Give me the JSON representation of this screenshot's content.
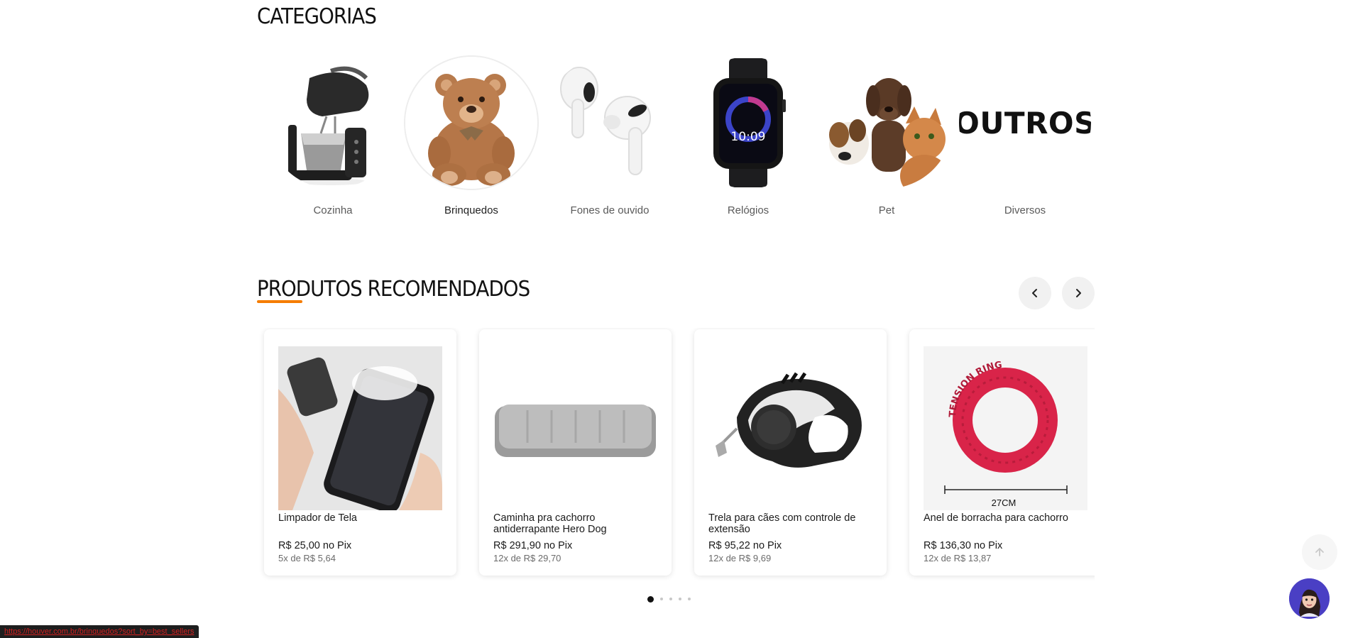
{
  "categories": {
    "title": "CATEGORIAS",
    "items": [
      {
        "label": "Cozinha",
        "icon": "stand-mixer-image"
      },
      {
        "label": "Brinquedos",
        "icon": "teddy-bear-image"
      },
      {
        "label": "Fones de ouvido",
        "icon": "earbuds-image"
      },
      {
        "label": "Relógios",
        "icon": "smartwatch-image",
        "watch_time": "10:09"
      },
      {
        "label": "Pet",
        "icon": "dogs-cat-image"
      },
      {
        "label": "Diversos",
        "image_text": "OUTROS"
      }
    ]
  },
  "recommended": {
    "title": "PRODUTOS RECOMENDADOS",
    "prev_icon": "chevron-left-icon",
    "next_icon": "chevron-right-icon",
    "products": [
      {
        "name": "Limpador de Tela",
        "price": "R$ 25,00 no Pix",
        "installments": "5x de R$ 5,64"
      },
      {
        "name": "Caminha pra cachorro antiderrapante Hero Dog",
        "price": "R$ 291,90 no Pix",
        "installments": "12x de R$ 29,70"
      },
      {
        "name": "Trela para cães com controle de extensão",
        "price": "R$ 95,22 no Pix",
        "installments": "12x de R$ 9,69"
      },
      {
        "name": "Anel de borracha para cachorro",
        "price": "R$ 136,30 no Pix",
        "installments": "12x de R$ 13,87",
        "image_caption": "27CM",
        "image_arc_text": "TENSION RING"
      }
    ],
    "pagination": {
      "count": 5,
      "active": 0
    }
  },
  "floating": {
    "back_to_top_icon": "arrow-up-icon",
    "chat_icon": "assistant-avatar-icon"
  },
  "status_bar": {
    "url": "https://houver.com.br/brinquedos?sort_by=best_sellers"
  },
  "colors": {
    "accent": "#f57c00",
    "chat": "#4a3fc4",
    "status_text": "#d02020"
  }
}
